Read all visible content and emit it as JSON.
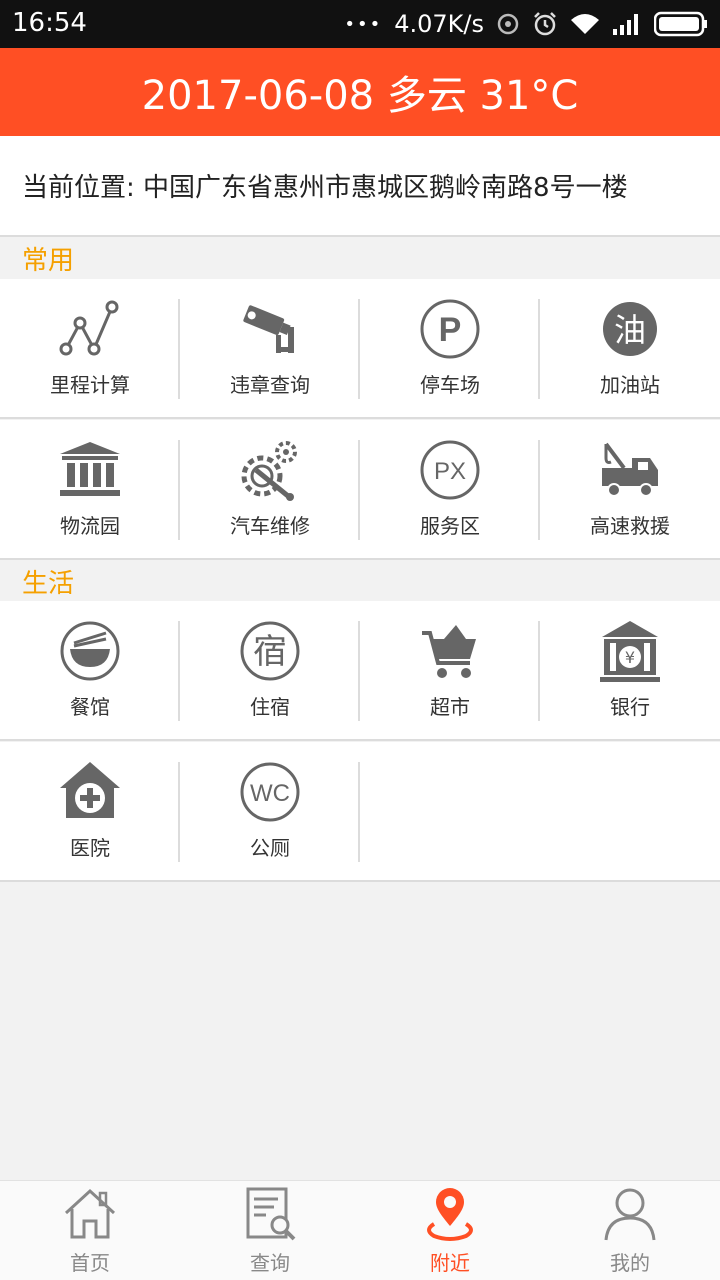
{
  "status_bar": {
    "time": "16:54",
    "dots": "•••",
    "network_speed": "4.07K/s"
  },
  "header": {
    "title": "2017-06-08 多云 31°C"
  },
  "location": {
    "text": "当前位置: 中国广东省惠州市惠城区鹅岭南路8号一楼"
  },
  "sections": [
    {
      "title": "常用"
    },
    {
      "title": "生活"
    }
  ],
  "common": [
    {
      "label": "里程计算",
      "icon": "mileage-chart-icon"
    },
    {
      "label": "违章查询",
      "icon": "camera-icon"
    },
    {
      "label": "停车场",
      "icon": "parking-icon",
      "glyph": "P"
    },
    {
      "label": "加油站",
      "icon": "gas-station-icon",
      "glyph": "油"
    },
    {
      "label": "物流园",
      "icon": "building-icon"
    },
    {
      "label": "汽车维修",
      "icon": "repair-icon"
    },
    {
      "label": "服务区",
      "icon": "service-area-icon",
      "glyph": "PX"
    },
    {
      "label": "高速救援",
      "icon": "tow-truck-icon"
    }
  ],
  "life": [
    {
      "label": "餐馆",
      "icon": "restaurant-icon"
    },
    {
      "label": "住宿",
      "icon": "hotel-icon",
      "glyph": "宿"
    },
    {
      "label": "超市",
      "icon": "shopping-cart-icon"
    },
    {
      "label": "银行",
      "icon": "bank-icon",
      "glyph": "¥"
    },
    {
      "label": "医院",
      "icon": "hospital-icon"
    },
    {
      "label": "公厕",
      "icon": "toilet-icon",
      "glyph": "WC"
    }
  ],
  "tabs": [
    {
      "label": "首页",
      "icon": "home-icon",
      "active": false
    },
    {
      "label": "查询",
      "icon": "query-icon",
      "active": false
    },
    {
      "label": "附近",
      "icon": "location-pin-icon",
      "active": true
    },
    {
      "label": "我的",
      "icon": "user-icon",
      "active": false
    }
  ],
  "colors": {
    "accent": "#ff4f24",
    "section_title": "#f5a000",
    "icon_gray": "#666666",
    "active_tab": "#ff4f24"
  }
}
